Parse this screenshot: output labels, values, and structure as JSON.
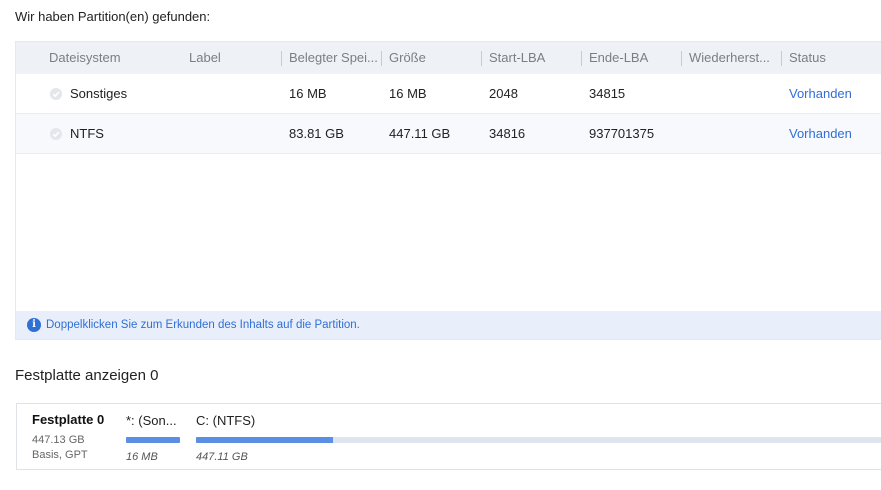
{
  "heading": "Wir haben Partition(en) gefunden:",
  "table": {
    "columns": [
      "Dateisystem",
      "Label",
      "Belegter Spei...",
      "Größe",
      "Start-LBA",
      "Ende-LBA",
      "Wiederherst...",
      "Status"
    ],
    "rows": [
      {
        "checked": true,
        "filesystem": "Sonstiges",
        "label": "",
        "used": "16 MB",
        "size": "16 MB",
        "start_lba": "2048",
        "end_lba": "34815",
        "recover": "",
        "status": "Vorhanden"
      },
      {
        "checked": true,
        "filesystem": "NTFS",
        "label": "",
        "used": "83.81 GB",
        "size": "447.11 GB",
        "start_lba": "34816",
        "end_lba": "937701375",
        "recover": "",
        "status": "Vorhanden"
      }
    ]
  },
  "info": {
    "text": "Doppelklicken Sie zum Erkunden des Inhalts auf die Partition.",
    "icon": "info-icon"
  },
  "disk_section": {
    "title": "Festplatte anzeigen 0",
    "disk_name": "Festplatte 0",
    "disk_size": "447.13 GB",
    "disk_type": "Basis, GPT",
    "partitions": [
      {
        "label": "*: (Son...",
        "size": "16 MB",
        "fill_fraction": 1.0
      },
      {
        "label": "C: (NTFS)",
        "size": "447.11 GB",
        "fill_fraction": 0.2
      }
    ]
  },
  "colors": {
    "accent": "#2f6fd6",
    "bar_fill": "#5b8fe6",
    "header_bg": "#eef1f5"
  }
}
